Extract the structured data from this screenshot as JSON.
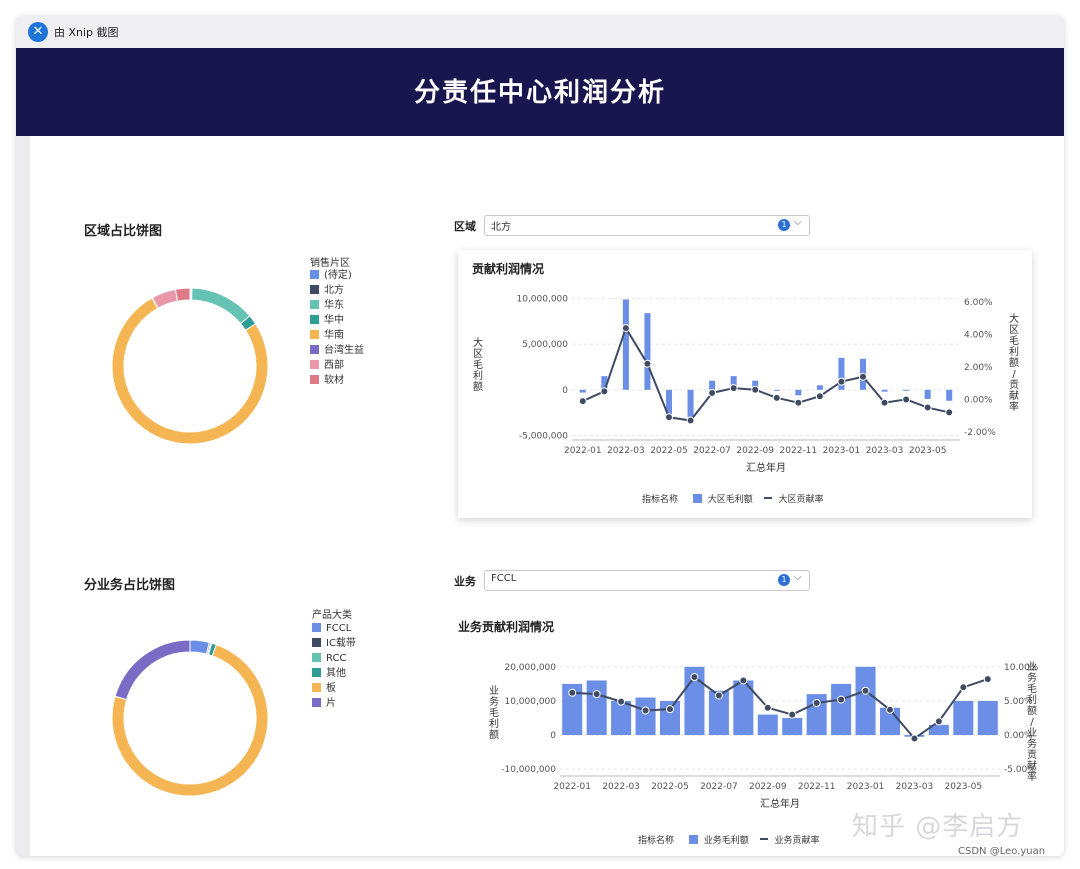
{
  "window": {
    "title": "由 Xnip 截图",
    "app_icon": "xnip-icon"
  },
  "page": {
    "title": "分责任中心利润分析"
  },
  "colors": {
    "banner": "#19154f",
    "bar": "#6b8fe6",
    "line": "#3f4a63"
  },
  "region_section": {
    "title": "区域占比饼图",
    "legend_title": "销售片区",
    "legend": [
      "(待定)",
      "北方",
      "华东",
      "华中",
      "华南",
      "台湾生益",
      "西部",
      "软材"
    ],
    "legend_colors": [
      "#6b8fe6",
      "#3f4a63",
      "#66c2b3",
      "#2f9c96",
      "#f5b553",
      "#7a6bc4",
      "#e898a8",
      "#dd7a86"
    ],
    "filter": {
      "label": "区域",
      "value": "北方",
      "badge": "1"
    }
  },
  "business_section": {
    "title": "分业务占比饼图",
    "legend_title": "产品大类",
    "legend": [
      "FCCL",
      "IC载带",
      "RCC",
      "其他",
      "板",
      "片"
    ],
    "legend_colors": [
      "#6b8fe6",
      "#3f4a63",
      "#66c2b3",
      "#2f9c96",
      "#f5b553",
      "#7a6bc4"
    ],
    "filter": {
      "label": "业务",
      "value": "FCCL",
      "badge": "1"
    }
  },
  "region_chart": {
    "title": "贡献利润情况",
    "legend_label": "指标名称",
    "legend_bar": "大区毛利额",
    "legend_line": "大区贡献率"
  },
  "business_chart": {
    "title": "业务贡献利润情况",
    "legend_label": "指标名称",
    "legend_bar": "业务毛利额",
    "legend_line": "业务贡献率"
  },
  "watermark": "知乎 @李启方",
  "credit": "CSDN @Leo.yuan",
  "chart_data": [
    {
      "type": "pie",
      "variant": "donut",
      "title": "区域占比饼图",
      "legend_title": "销售片区",
      "categories": [
        "(待定)",
        "北方",
        "华东",
        "华中",
        "华南",
        "台湾生益",
        "西部",
        "软材"
      ],
      "values": [
        0.2,
        0.2,
        13.5,
        2.0,
        76.0,
        0.1,
        5.0,
        3.0
      ],
      "colors": [
        "#6b8fe6",
        "#3f4a63",
        "#66c2b3",
        "#2f9c96",
        "#f5b553",
        "#7a6bc4",
        "#e898a8",
        "#dd7a86"
      ]
    },
    {
      "type": "bar",
      "combo": "bar+line",
      "title": "贡献利润情况",
      "x": [
        "2022-01",
        "2022-02",
        "2022-03",
        "2022-04",
        "2022-05",
        "2022-06",
        "2022-07",
        "2022-08",
        "2022-09",
        "2022-10",
        "2022-11",
        "2022-12",
        "2023-01",
        "2023-02",
        "2023-03",
        "2023-04",
        "2023-05",
        "2023-06"
      ],
      "xticks": [
        "2022-01",
        "2022-03",
        "2022-05",
        "2022-07",
        "2022-09",
        "2022-11",
        "2023-01",
        "2023-03",
        "2023-05"
      ],
      "xlabel": "汇总年月",
      "ylabel": "大区毛利额",
      "y2label": "大区毛利额/贡献率",
      "ylim": [
        -5500000,
        10500000
      ],
      "yticks": [
        10000000,
        5000000,
        0,
        -5000000
      ],
      "ytick_labels": [
        "10,000,000",
        "5,000,000",
        "0",
        "-5,000,000"
      ],
      "y2lim": [
        -2.5,
        6.5
      ],
      "y2ticks": [
        6,
        4,
        2,
        0,
        -2
      ],
      "y2tick_labels": [
        "6.00%",
        "4.00%",
        "2.00%",
        "0.00%",
        "-2.00%"
      ],
      "series": [
        {
          "name": "大区毛利额",
          "type": "bar",
          "values": [
            -300000,
            1500000,
            9900000,
            8400000,
            -2800000,
            -3000000,
            1000000,
            1500000,
            1000000,
            -100000,
            -600000,
            500000,
            3500000,
            3400000,
            -200000,
            -100000,
            -1000000,
            -1200000
          ]
        },
        {
          "name": "大区贡献率",
          "type": "line",
          "values": [
            -0.1,
            0.5,
            4.4,
            2.2,
            -1.1,
            -1.3,
            0.4,
            0.7,
            0.6,
            0.1,
            -0.2,
            0.2,
            1.1,
            1.4,
            -0.2,
            0.0,
            -0.5,
            -0.8
          ]
        }
      ]
    },
    {
      "type": "pie",
      "variant": "donut",
      "title": "分业务占比饼图",
      "legend_title": "产品大类",
      "categories": [
        "FCCL",
        "IC载带",
        "RCC",
        "其他",
        "板",
        "片"
      ],
      "values": [
        4.0,
        0.3,
        0.2,
        1.0,
        74.0,
        20.5
      ],
      "colors": [
        "#6b8fe6",
        "#3f4a63",
        "#66c2b3",
        "#2f9c96",
        "#f5b553",
        "#7a6bc4"
      ]
    },
    {
      "type": "bar",
      "combo": "bar+line",
      "title": "业务贡献利润情况",
      "x": [
        "2022-01",
        "2022-02",
        "2022-03",
        "2022-04",
        "2022-05",
        "2022-06",
        "2022-07",
        "2022-08",
        "2022-09",
        "2022-10",
        "2022-11",
        "2022-12",
        "2023-01",
        "2023-02",
        "2023-03",
        "2023-04",
        "2023-05",
        "2023-06"
      ],
      "xticks": [
        "2022-01",
        "2022-03",
        "2022-05",
        "2022-07",
        "2022-09",
        "2022-11",
        "2023-01",
        "2023-03",
        "2023-05"
      ],
      "xlabel": "汇总年月",
      "ylabel": "业务毛利额",
      "y2label": "业务毛利额/业务贡献率",
      "ylim": [
        -12000000,
        22000000
      ],
      "yticks": [
        20000000,
        10000000,
        0,
        -10000000
      ],
      "ytick_labels": [
        "20,000,000",
        "10,000,000",
        "0",
        "-10,000,000"
      ],
      "y2lim": [
        -6,
        11
      ],
      "y2ticks": [
        10,
        5,
        0,
        -5
      ],
      "y2tick_labels": [
        "10.00%",
        "5.00%",
        "0.00%",
        "-5.00%"
      ],
      "series": [
        {
          "name": "业务毛利额",
          "type": "bar",
          "values": [
            15000000,
            16000000,
            10000000,
            11000000,
            10000000,
            20000000,
            13000000,
            16000000,
            6000000,
            5000000,
            12000000,
            15000000,
            20000000,
            8000000,
            -500000,
            3000000,
            10000000,
            10000000
          ]
        },
        {
          "name": "业务贡献率",
          "type": "line",
          "values": [
            6.2,
            6.0,
            4.9,
            3.6,
            3.8,
            8.5,
            5.8,
            8.0,
            4.0,
            3.0,
            4.7,
            5.2,
            6.5,
            3.7,
            -0.5,
            2.0,
            7.0,
            8.2
          ]
        }
      ]
    }
  ]
}
